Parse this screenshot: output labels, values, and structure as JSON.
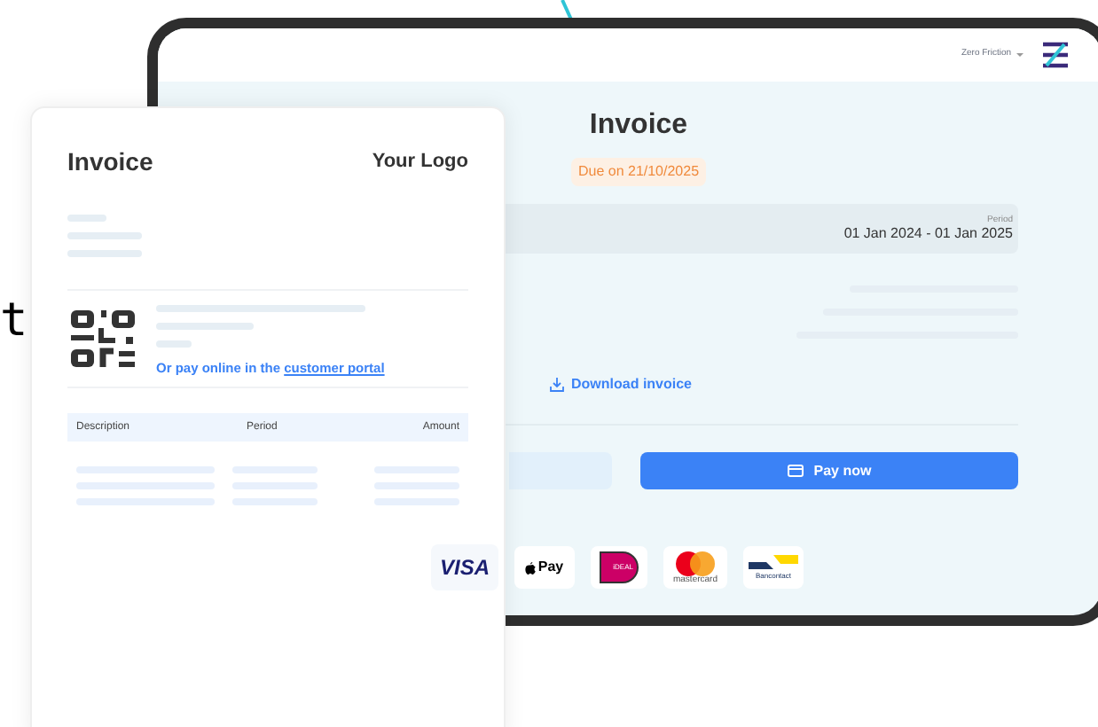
{
  "edge_text": "t",
  "tablet": {
    "account": "Zero Friction",
    "title": "Invoice",
    "due": "Due on 21/10/2025",
    "period_label": "Period",
    "period_value": "01 Jan 2024 - 01 Jan 2025",
    "download": "Download invoice",
    "pay_button": "Pay now"
  },
  "paper": {
    "title": "Invoice",
    "logo_text": "Your Logo",
    "portal_text": "Or pay online in the",
    "portal_link": "customer portal",
    "columns": [
      "Description",
      "Period",
      "Amount"
    ]
  },
  "payment_methods": [
    {
      "kind": "visa",
      "label": "VISA"
    },
    {
      "kind": "applepay",
      "label": "Pay"
    },
    {
      "kind": "ideal",
      "label": "iDEAL"
    },
    {
      "kind": "mastercard",
      "label": "mastercard"
    },
    {
      "kind": "bancontact",
      "label": "Bancontact"
    }
  ]
}
